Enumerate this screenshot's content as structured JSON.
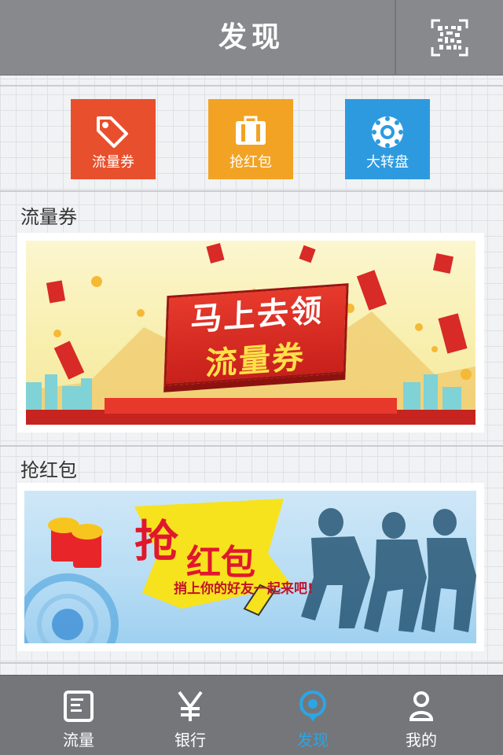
{
  "header": {
    "title": "发现",
    "qr_icon": "qr-code-icon"
  },
  "tiles": [
    {
      "label": "流量券",
      "icon": "tag-icon",
      "color": "#e8502d"
    },
    {
      "label": "抢红包",
      "icon": "briefcase-icon",
      "color": "#f2a324"
    },
    {
      "label": "大转盘",
      "icon": "wheel-icon",
      "color": "#2d9ae0"
    }
  ],
  "sections": [
    {
      "title": "流量券",
      "banner": {
        "line1": "马上去领",
        "line2": "流量券"
      }
    },
    {
      "title": "抢红包",
      "banner": {
        "char": "抢",
        "line": "红包",
        "sub": "捎上你的好友一起来吧!"
      }
    }
  ],
  "tabbar": {
    "items": [
      {
        "label": "流量",
        "icon": "document-icon"
      },
      {
        "label": "银行",
        "icon": "yen-icon"
      },
      {
        "label": "发现",
        "icon": "location-icon"
      },
      {
        "label": "我的",
        "icon": "person-icon"
      }
    ],
    "active_color": "#2aa6e6"
  }
}
